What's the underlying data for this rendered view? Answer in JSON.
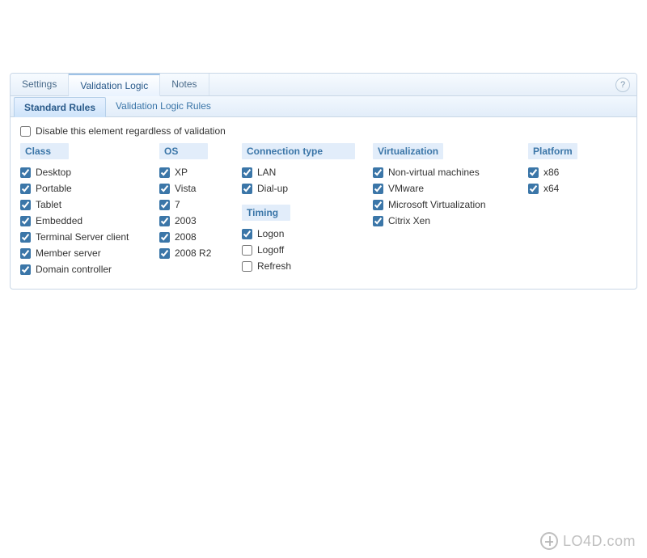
{
  "tabs": {
    "settings": "Settings",
    "validation_logic": "Validation Logic",
    "notes": "Notes",
    "active": "validation_logic"
  },
  "help_icon": "?",
  "subtabs": {
    "standard_rules": "Standard Rules",
    "validation_logic_rules": "Validation Logic Rules",
    "active": "standard_rules"
  },
  "disable_row": {
    "label": "Disable this element regardless of validation",
    "checked": false
  },
  "columns": {
    "class": {
      "header": "Class",
      "items": [
        {
          "label": "Desktop",
          "checked": true
        },
        {
          "label": "Portable",
          "checked": true
        },
        {
          "label": "Tablet",
          "checked": true
        },
        {
          "label": "Embedded",
          "checked": true
        },
        {
          "label": "Terminal Server client",
          "checked": true
        },
        {
          "label": "Member server",
          "checked": true
        },
        {
          "label": "Domain controller",
          "checked": true
        }
      ]
    },
    "os": {
      "header": "OS",
      "items": [
        {
          "label": "XP",
          "checked": true
        },
        {
          "label": "Vista",
          "checked": true
        },
        {
          "label": "7",
          "checked": true
        },
        {
          "label": "2003",
          "checked": true
        },
        {
          "label": "2008",
          "checked": true
        },
        {
          "label": "2008 R2",
          "checked": true
        }
      ]
    },
    "connection": {
      "header": "Connection type",
      "items": [
        {
          "label": "LAN",
          "checked": true
        },
        {
          "label": "Dial-up",
          "checked": true
        }
      ]
    },
    "timing": {
      "header": "Timing",
      "items": [
        {
          "label": "Logon",
          "checked": true
        },
        {
          "label": "Logoff",
          "checked": false
        },
        {
          "label": "Refresh",
          "checked": false
        }
      ]
    },
    "virtualization": {
      "header": "Virtualization",
      "items": [
        {
          "label": "Non-virtual machines",
          "checked": true
        },
        {
          "label": "VMware",
          "checked": true
        },
        {
          "label": "Microsoft Virtualization",
          "checked": true
        },
        {
          "label": "Citrix Xen",
          "checked": true
        }
      ]
    },
    "platform": {
      "header": "Platform",
      "items": [
        {
          "label": "x86",
          "checked": true
        },
        {
          "label": "x64",
          "checked": true
        }
      ]
    }
  },
  "watermark": "LO4D.com"
}
